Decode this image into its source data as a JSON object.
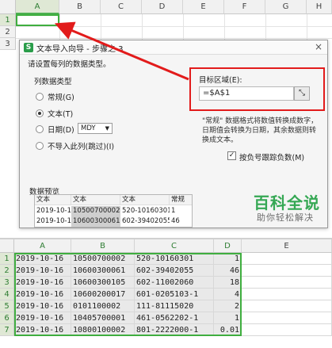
{
  "top_sheet": {
    "columns": [
      "A",
      "B",
      "C",
      "D",
      "E",
      "F",
      "G",
      "H"
    ],
    "rows": [
      "1",
      "2",
      "3"
    ]
  },
  "dialog": {
    "title": "文本导入向导 - 步骤之 3",
    "close_glyph": "×",
    "instruction": "请设置每列的数据类型。",
    "group_label": "列数据类型",
    "options": [
      "常规(G)",
      "文本(T)",
      "日期(D)",
      "不导入此列(跳过)(I)"
    ],
    "date_format": "MDY",
    "target_label": "目标区域(E):",
    "target_value": "=$A$1",
    "note": "\"常规\" 数据格式将数值转换成数字，日期值会转换为日期，其余数据则转换成文本。",
    "checkbox_label": "按负号跟踪负数(M)",
    "checkbox_mark": "✓",
    "preview_label": "数据预览",
    "preview_headers": [
      "文本",
      "文本",
      "文本",
      "常规"
    ],
    "preview_rows": [
      [
        "2019-10-16",
        "10500700002",
        "520-10160301",
        "1"
      ],
      [
        "2019-10-16",
        "10600300061",
        "602-39402055",
        "46"
      ]
    ]
  },
  "watermark": {
    "main": "百科全说",
    "sub": "助你轻松解决"
  },
  "bottom_sheet": {
    "columns": [
      "A",
      "B",
      "C",
      "D",
      "E"
    ],
    "rows": [
      {
        "n": "1",
        "a": "2019-10-16",
        "b": "10500700002",
        "c": "520-10160301",
        "d": "1"
      },
      {
        "n": "2",
        "a": "2019-10-16",
        "b": "10600300061",
        "c": "602-39402055",
        "d": "46"
      },
      {
        "n": "3",
        "a": "2019-10-16",
        "b": "10600300105",
        "c": "602-11002060",
        "d": "18"
      },
      {
        "n": "4",
        "a": "2019-10-16",
        "b": "10600200017",
        "c": "601-0205103-1",
        "d": "4"
      },
      {
        "n": "5",
        "a": "2019-10-16",
        "b": "0101100002",
        "c": "111-81115020",
        "d": "2"
      },
      {
        "n": "6",
        "a": "2019-10-16",
        "b": "10405700001",
        "c": "461-0562202-1",
        "d": "1"
      },
      {
        "n": "7",
        "a": "2019-10-16",
        "b": "10800100002",
        "c": "801-2222000-1",
        "d": "0.01"
      }
    ]
  },
  "colors": {
    "accent_green": "#3fae3f",
    "highlight_red": "#e21b1b",
    "watermark_green": "#35a854"
  }
}
